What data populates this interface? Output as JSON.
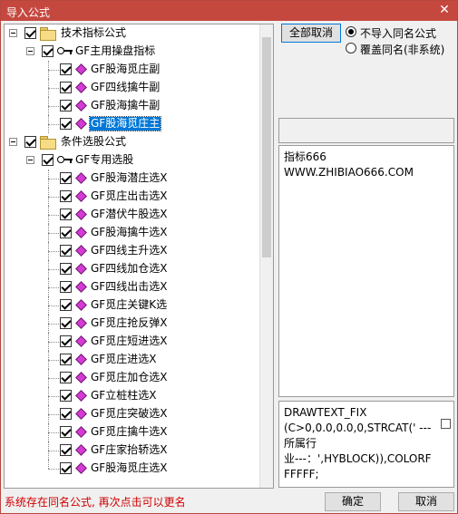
{
  "window": {
    "title": "导入公式",
    "close_glyph": "✕"
  },
  "tree": {
    "items": [
      {
        "label": "技术指标公式",
        "kind": "folder",
        "level": 0,
        "expanded": true,
        "checked": true
      },
      {
        "label": "GF主用操盘指标",
        "kind": "key",
        "level": 1,
        "expanded": true,
        "checked": true
      },
      {
        "label": "GF股海觅庄副",
        "kind": "formula",
        "level": 2,
        "checked": true
      },
      {
        "label": "GF四线擒牛副",
        "kind": "formula",
        "level": 2,
        "checked": true
      },
      {
        "label": "GF股海擒牛副",
        "kind": "formula",
        "level": 2,
        "checked": true
      },
      {
        "label": "GF股海觅庄主",
        "kind": "formula",
        "level": 2,
        "checked": true,
        "selected": true
      },
      {
        "label": "条件选股公式",
        "kind": "folder",
        "level": 0,
        "expanded": true,
        "checked": true
      },
      {
        "label": "GF专用选股",
        "kind": "key",
        "level": 1,
        "expanded": true,
        "checked": true
      },
      {
        "label": "GF股海潜庄选X",
        "kind": "formula",
        "level": 2,
        "checked": true
      },
      {
        "label": "GF觅庄出击选X",
        "kind": "formula",
        "level": 2,
        "checked": true
      },
      {
        "label": "GF潜伏牛股选X",
        "kind": "formula",
        "level": 2,
        "checked": true
      },
      {
        "label": "GF股海擒牛选X",
        "kind": "formula",
        "level": 2,
        "checked": true
      },
      {
        "label": "GF四线主升选X",
        "kind": "formula",
        "level": 2,
        "checked": true
      },
      {
        "label": "GF四线加仓选X",
        "kind": "formula",
        "level": 2,
        "checked": true
      },
      {
        "label": "GF四线出击选X",
        "kind": "formula",
        "level": 2,
        "checked": true
      },
      {
        "label": "GF觅庄关键K选",
        "kind": "formula",
        "level": 2,
        "checked": true
      },
      {
        "label": "GF觅庄抢反弹X",
        "kind": "formula",
        "level": 2,
        "checked": true
      },
      {
        "label": "GF觅庄短进选X",
        "kind": "formula",
        "level": 2,
        "checked": true
      },
      {
        "label": "GF觅庄进选X",
        "kind": "formula",
        "level": 2,
        "checked": true
      },
      {
        "label": "GF觅庄加仓选X",
        "kind": "formula",
        "level": 2,
        "checked": true
      },
      {
        "label": "GF立桩柱选X",
        "kind": "formula",
        "level": 2,
        "checked": true
      },
      {
        "label": "GF觅庄突破选X",
        "kind": "formula",
        "level": 2,
        "checked": true
      },
      {
        "label": "GF觅庄擒牛选X",
        "kind": "formula",
        "level": 2,
        "checked": true
      },
      {
        "label": "GF庄家抬轿选X",
        "kind": "formula",
        "level": 2,
        "checked": true
      },
      {
        "label": "GF股海觅庄选X",
        "kind": "formula",
        "level": 2,
        "checked": true
      }
    ]
  },
  "controls": {
    "cancel_all_label": "全部取消",
    "radio_no_import_label": "不导入同名公式",
    "radio_overwrite_label": "覆盖同名(非系统)"
  },
  "description": {
    "text": "指标666\nWWW.ZHIBIAO666.COM"
  },
  "source": {
    "text": "DRAWTEXT_FIX\n(C>0,0.0,0.0,0,STRCAT(' ---所属行\n业---：',HYBLOCK)),COLORFFFFFF;"
  },
  "status_text": "系统存在同名公式, 再次点击可以更名",
  "footer": {
    "ok_label": "确定",
    "cancel_label": "取消"
  }
}
